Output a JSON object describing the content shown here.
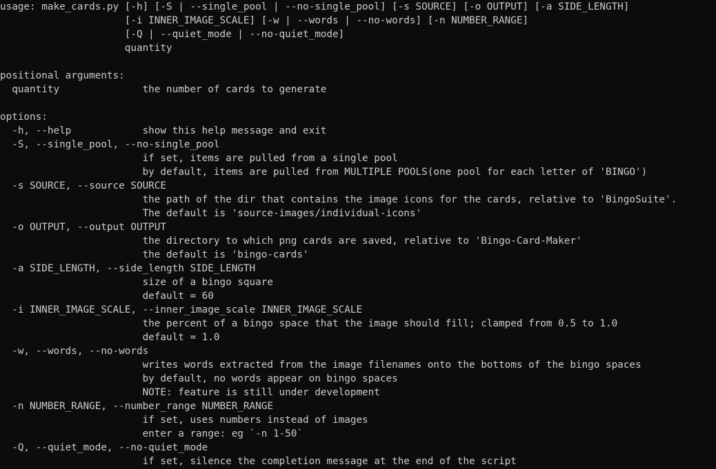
{
  "terminal": {
    "lines": [
      "usage: make_cards.py [-h] [-S | --single_pool | --no-single_pool] [-s SOURCE] [-o OUTPUT] [-a SIDE_LENGTH]",
      "                     [-i INNER_IMAGE_SCALE] [-w | --words | --no-words] [-n NUMBER_RANGE]",
      "                     [-Q | --quiet_mode | --no-quiet_mode]",
      "                     quantity",
      "",
      "positional arguments:",
      "  quantity              the number of cards to generate",
      "",
      "options:",
      "  -h, --help            show this help message and exit",
      "  -S, --single_pool, --no-single_pool",
      "                        if set, items are pulled from a single pool",
      "                        by default, items are pulled from MULTIPLE POOLS(one pool for each letter of 'BINGO')",
      "  -s SOURCE, --source SOURCE",
      "                        the path of the dir that contains the image icons for the cards, relative to 'BingoSuite'.",
      "                        The default is 'source-images/individual-icons'",
      "  -o OUTPUT, --output OUTPUT",
      "                        the directory to which png cards are saved, relative to 'Bingo-Card-Maker'",
      "                        the default is 'bingo-cards'",
      "  -a SIDE_LENGTH, --side_length SIDE_LENGTH",
      "                        size of a bingo square",
      "                        default = 60",
      "  -i INNER_IMAGE_SCALE, --inner_image_scale INNER_IMAGE_SCALE",
      "                        the percent of a bingo space that the image should fill; clamped from 0.5 to 1.0",
      "                        default = 1.0",
      "  -w, --words, --no-words",
      "                        writes words extracted from the image filenames onto the bottoms of the bingo spaces",
      "                        by default, no words appear on bingo spaces",
      "                        NOTE: feature is still under development",
      "  -n NUMBER_RANGE, --number_range NUMBER_RANGE",
      "                        if set, uses numbers instead of images",
      "                        enter a range: eg `-n 1-50`",
      "  -Q, --quiet_mode, --no-quiet_mode",
      "                        if set, silence the completion message at the end of the script"
    ]
  },
  "colors": {
    "background": "#0c0c0c",
    "foreground": "#cccccc"
  }
}
